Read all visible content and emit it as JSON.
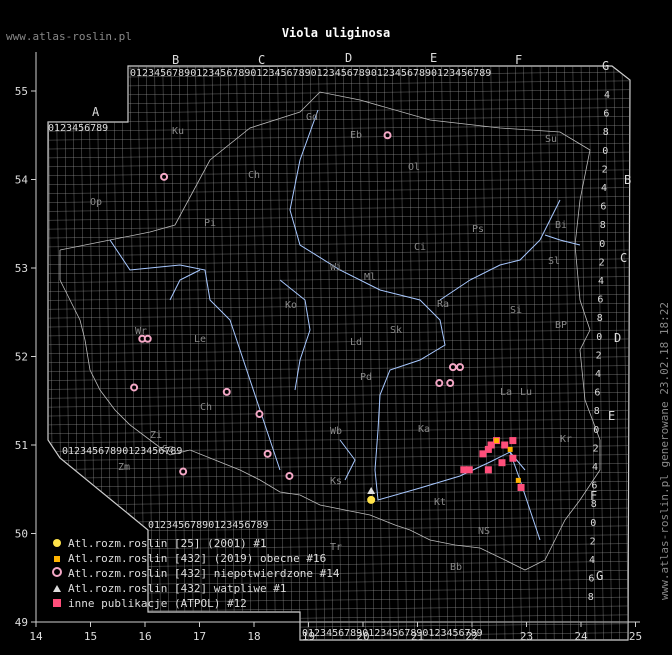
{
  "title": "Viola uliginosa",
  "site_topleft": "www.atlas-roslin.pl",
  "side_note": "www.atlas-roslin.pl generowane 23.02.18 18:22",
  "axes": {
    "lon_labels": [
      "14",
      "15",
      "16",
      "17",
      "18",
      "19",
      "20",
      "21",
      "22",
      "23",
      "24",
      "25"
    ],
    "lat_labels": [
      "55",
      "54",
      "53",
      "52",
      "51",
      "50",
      "49"
    ]
  },
  "atpol": {
    "column_letters": [
      "A",
      "B",
      "C",
      "D",
      "E",
      "F",
      "G"
    ],
    "row_letters": [
      "B",
      "C",
      "D",
      "E",
      "F",
      "G"
    ],
    "digits_row": "0123456789",
    "side_digits": [
      "4",
      "6",
      "8",
      "0",
      "2",
      "4",
      "6",
      "8",
      "0",
      "2",
      "4",
      "6",
      "8",
      "0",
      "2",
      "4",
      "6",
      "8",
      "0",
      "2",
      "4",
      "6",
      "8",
      "0",
      "2",
      "4",
      "6",
      "8"
    ]
  },
  "regions": [
    "Ku",
    "Gd",
    "Eb",
    "Su",
    "Sl",
    "Ch",
    "Ol",
    "Pi",
    "Bi",
    "Wi",
    "Ci",
    "Ml",
    "Ps",
    "Ko",
    "Ld",
    "Sk",
    "Pd",
    "Le",
    "Ka",
    "Si",
    "BP",
    "Lu",
    "Ch",
    "Wr",
    "Zi",
    "Wb",
    "Ks",
    "Kt",
    "Tr",
    "Bb",
    "NS",
    "Kr",
    "Zm",
    "Op",
    "Sz",
    "Ra",
    "La"
  ],
  "legend": [
    {
      "symbol": "yellow-dot-icon",
      "label": "Atl.rozm.roslin [25] (2001) #1"
    },
    {
      "symbol": "orange-square-icon",
      "label": "Atl.rozm.roslin [432] (2019) obecne #16"
    },
    {
      "symbol": "pink-ring-icon",
      "label": "Atl.rozm.roslin [432] niepotwierdzone #14"
    },
    {
      "symbol": "triangle-icon",
      "label": "Atl.rozm.roslin [432] watpliwe #1"
    },
    {
      "symbol": "pink-square-icon",
      "label": "inne publikacje (ATPOL) #12"
    }
  ],
  "records": {
    "rings": [
      [
        20.45,
        54.5
      ],
      [
        16.35,
        54.03
      ],
      [
        15.95,
        52.2
      ],
      [
        16.05,
        52.2
      ],
      [
        15.8,
        51.65
      ],
      [
        17.5,
        51.6
      ],
      [
        18.1,
        51.35
      ],
      [
        16.7,
        50.7
      ],
      [
        18.25,
        50.9
      ],
      [
        18.65,
        50.65
      ],
      [
        21.4,
        51.7
      ],
      [
        21.6,
        51.7
      ],
      [
        21.65,
        51.88
      ],
      [
        21.78,
        51.88
      ]
    ],
    "yellow": [
      [
        20.15,
        50.38
      ]
    ],
    "triangle": [
      [
        20.15,
        50.48
      ]
    ],
    "pink_squares": [
      [
        22.2,
        50.9
      ],
      [
        22.35,
        51.0
      ],
      [
        22.45,
        51.05
      ],
      [
        22.6,
        51.0
      ],
      [
        22.75,
        51.05
      ],
      [
        22.3,
        50.95
      ],
      [
        22.55,
        50.8
      ],
      [
        22.75,
        50.85
      ],
      [
        21.95,
        50.72
      ],
      [
        21.85,
        50.72
      ],
      [
        22.3,
        50.72
      ],
      [
        22.9,
        50.52
      ]
    ],
    "orange_squares": [
      [
        22.85,
        50.6
      ],
      [
        22.7,
        50.95
      ],
      [
        22.45,
        51.05
      ]
    ]
  },
  "colors": {
    "background": "#000000",
    "grid": "#9a9a9a",
    "border": "#cfcfcf",
    "rivers": "#a8c8ff",
    "ring": "#f4a8c6",
    "pink": "#ff4f7b",
    "orange": "#ffb300",
    "yellow": "#ffe34a"
  }
}
